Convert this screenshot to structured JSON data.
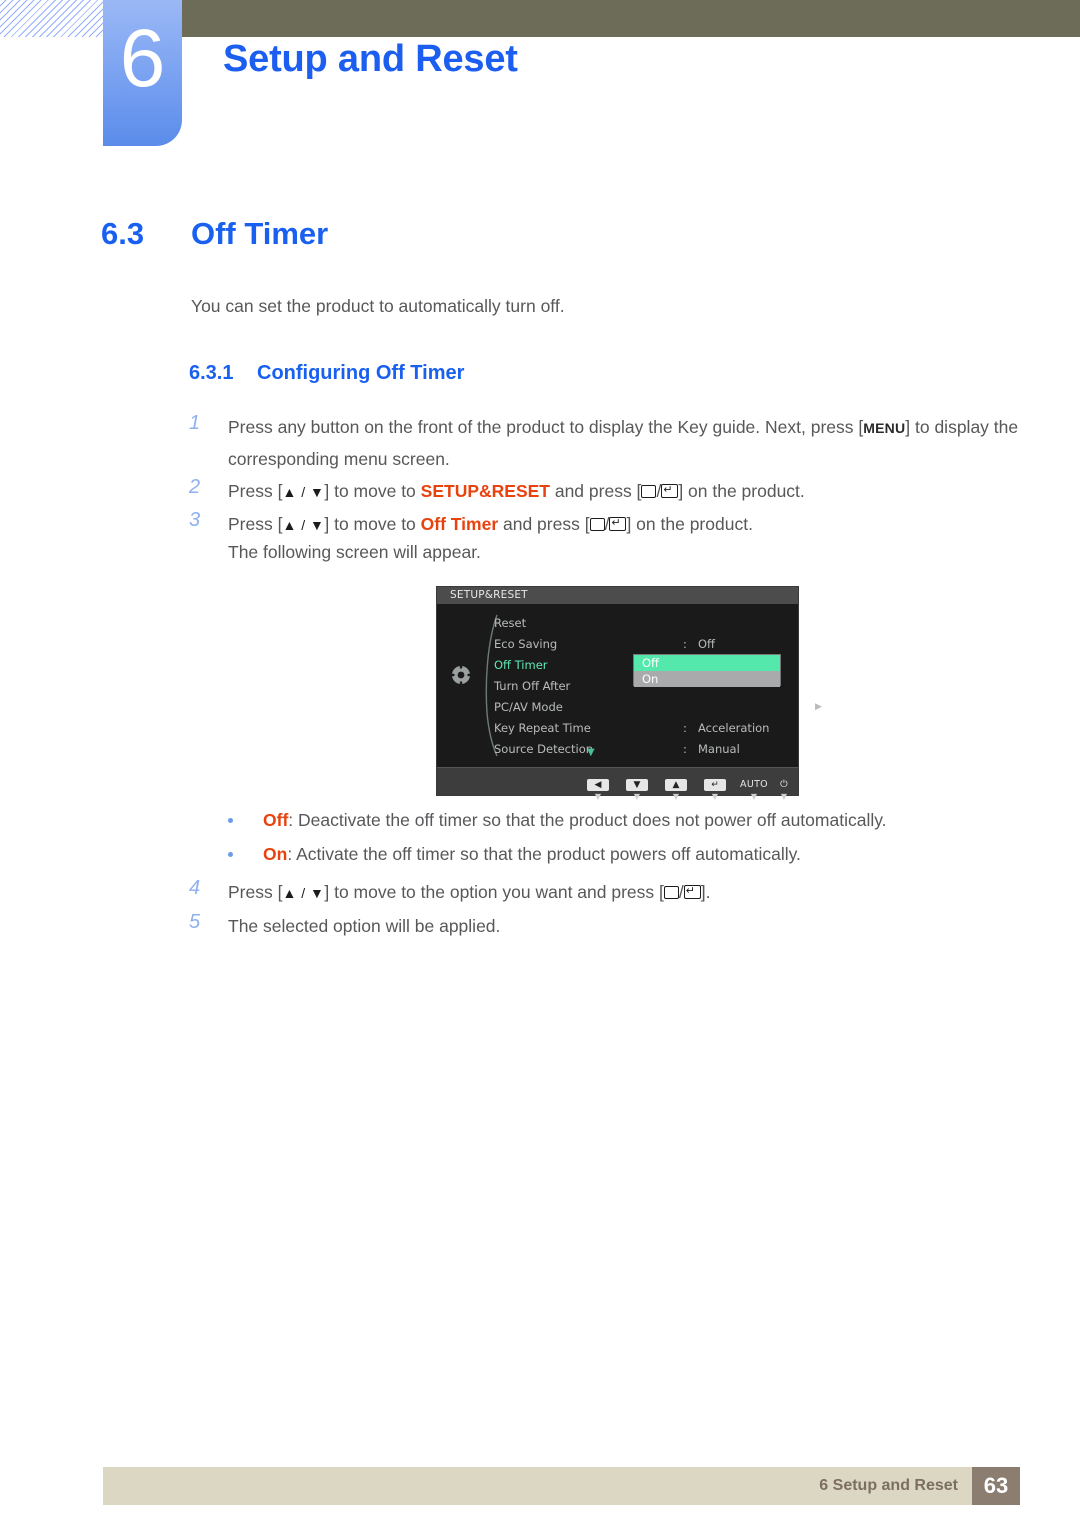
{
  "header": {
    "chapter_number": "6",
    "chapter_title": "Setup and Reset"
  },
  "section": {
    "number": "6.3",
    "title": "Off Timer",
    "intro": "You can set the product to automatically turn off.",
    "sub_number": "6.3.1",
    "sub_title": "Configuring Off Timer"
  },
  "steps": [
    {
      "num": "1",
      "pre": "Press any button on the front of the product to display the Key guide. Next, press [",
      "key": "MENU",
      "post": "] to display the corresponding menu screen."
    },
    {
      "num": "2",
      "pre": "Press [",
      "arrows": "▲ / ▼",
      "mid1": "] to move to ",
      "highlight": "SETUP&RESET",
      "mid2": " and press [",
      "post": "] on the product."
    },
    {
      "num": "3",
      "pre": "Press [",
      "arrows": "▲ / ▼",
      "mid1": "] to move to ",
      "highlight": "Off Timer",
      "mid2": " and press [",
      "post": "] on the product."
    }
  ],
  "after_step3": "The following screen will appear.",
  "osd": {
    "title": "SETUP&RESET",
    "rows": [
      {
        "label": "Reset",
        "colon": "",
        "value": "",
        "selected": false,
        "submenu": false
      },
      {
        "label": "Eco Saving",
        "colon": ":",
        "value": "Off",
        "selected": false,
        "submenu": false
      },
      {
        "label": "Off Timer",
        "colon": ":",
        "value": "",
        "selected": true,
        "submenu": false
      },
      {
        "label": "Turn Off After",
        "colon": "",
        "value": "",
        "selected": false,
        "submenu": false
      },
      {
        "label": "PC/AV Mode",
        "colon": "",
        "value": "",
        "selected": false,
        "submenu": true
      },
      {
        "label": "Key Repeat Time",
        "colon": ":",
        "value": "Acceleration",
        "selected": false,
        "submenu": false
      },
      {
        "label": "Source Detection",
        "colon": ":",
        "value": "Manual",
        "selected": false,
        "submenu": false
      }
    ],
    "dropdown": {
      "option_selected": "Off",
      "option_other": "On",
      "selected_bg": "#55e8ad",
      "other_bg": "#a8aaab"
    },
    "scroll_down": "▼",
    "keys": [
      {
        "name": "left-arrow-key",
        "glyph": "◀",
        "type": "box"
      },
      {
        "name": "down-arrow-key",
        "glyph": "▼",
        "type": "box"
      },
      {
        "name": "up-arrow-key",
        "glyph": "▲",
        "type": "box"
      },
      {
        "name": "enter-key",
        "glyph": "↵",
        "type": "box"
      },
      {
        "name": "auto-key",
        "glyph": "AUTO",
        "type": "text"
      },
      {
        "name": "power-key",
        "glyph": "⏻",
        "type": "text"
      }
    ],
    "key_caret": "▼"
  },
  "bullets": [
    {
      "term": "Off",
      "desc": ": Deactivate the off timer so that the product does not power off automatically."
    },
    {
      "term": "On",
      "desc": ": Activate the off timer so that the product powers off automatically."
    }
  ],
  "steps_tail": [
    {
      "num": "4",
      "pre": "Press [",
      "arrows": "▲ / ▼",
      "mid1": "] to move to the option you want and press [",
      "post": "]."
    },
    {
      "num": "5",
      "text": "The selected option will be applied."
    }
  ],
  "footer": {
    "text": "6 Setup and Reset",
    "page": "63"
  },
  "colors": {
    "heading_blue": "#1a60f0",
    "accent_orange": "#e8430f",
    "olive_bar": "#6d6c58",
    "tab_blue": "#7ea5f2",
    "footer_bar": "#dcd7c3",
    "footer_page_box": "#8b7d6f",
    "osd_highlight_green": "#5fe8b4"
  }
}
